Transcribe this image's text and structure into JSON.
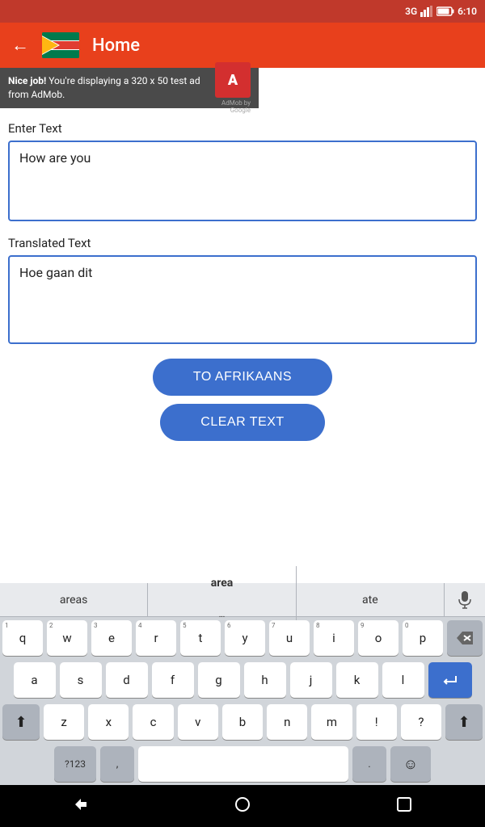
{
  "statusBar": {
    "signal": "3G",
    "battery": "🔋",
    "time": "6:10"
  },
  "navBar": {
    "title": "Home",
    "backArrow": "←"
  },
  "ad": {
    "text_bold": "Nice job!",
    "text_normal": " You're displaying a 320 x 50 test ad from AdMob.",
    "logo_letter": "A",
    "by": "AdMob by Google"
  },
  "enterTextLabel": "Enter Text",
  "inputText": "How are you",
  "translatedTextLabel": "Translated Text",
  "translatedText": "Hoe gaan dit",
  "buttons": {
    "toAfrikaans": "TO AFRIKAANS",
    "clearText": "CLEAR TEXT"
  },
  "keyboard": {
    "suggestions": [
      "areas",
      "area",
      "ate"
    ],
    "rows": [
      [
        "q",
        "w",
        "e",
        "r",
        "t",
        "y",
        "u",
        "i",
        "o",
        "p"
      ],
      [
        "a",
        "s",
        "d",
        "f",
        "g",
        "h",
        "j",
        "k",
        "l"
      ],
      [
        "↑",
        "z",
        "x",
        "c",
        "v",
        "b",
        "n",
        "m",
        "!",
        "↑"
      ],
      [
        "?123",
        ",",
        "(space)",
        ".",
        ":)"
      ]
    ],
    "numbers": [
      "1",
      "2",
      "3",
      "4",
      "5",
      "6",
      "7",
      "8",
      "9",
      "0"
    ]
  }
}
